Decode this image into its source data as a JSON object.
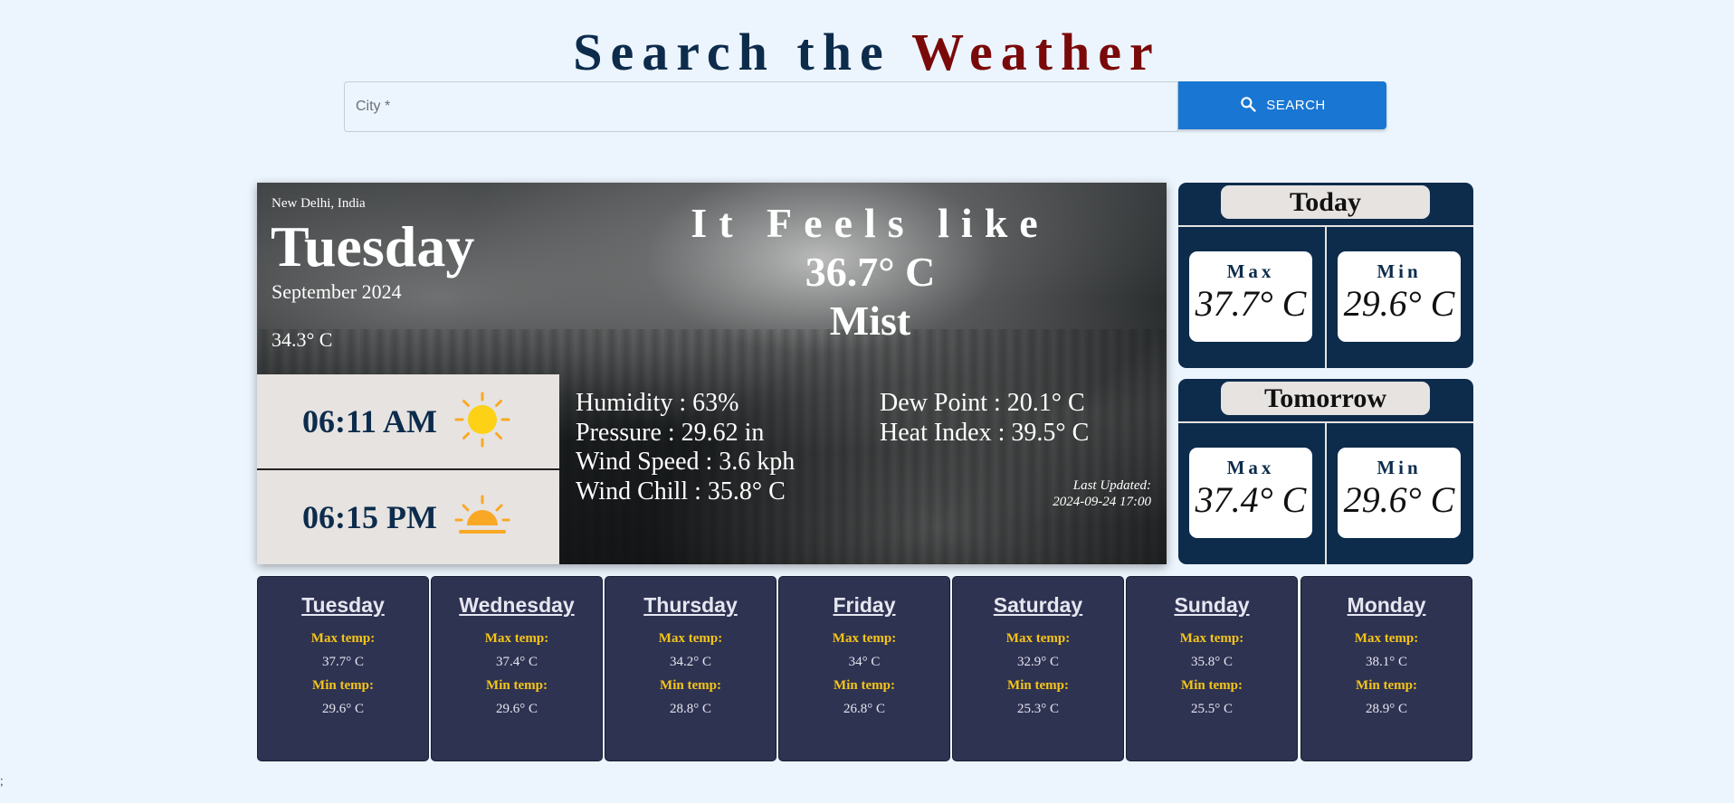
{
  "header": {
    "title_part1": "Search the",
    "title_part2": "Weather"
  },
  "search": {
    "placeholder": "City *",
    "value": "",
    "button_label": "SEARCH"
  },
  "current": {
    "location": "New Delhi, India",
    "day": "Tuesday",
    "month_year": "September 2024",
    "temperature": "34.3° C",
    "feels_like_label": "It Feels like",
    "feels_like_value": "36.7° C",
    "condition": "Mist",
    "sunrise": "06:11 AM",
    "sunset": "06:15 PM",
    "sunrise_icon": "sun-icon",
    "sunset_icon": "sunset-icon",
    "humidity": "Humidity : 63%",
    "pressure": "Pressure : 29.62 in",
    "wind_speed": "Wind Speed : 3.6 kph",
    "wind_chill": "Wind Chill : 35.8° C",
    "dew_point": "Dew Point : 20.1° C",
    "heat_index": "Heat Index : 39.5° C",
    "last_updated_label": "Last Updated:",
    "last_updated_value": "2024-09-24 17:00"
  },
  "today": {
    "title": "Today",
    "max_label": "Max",
    "max": "37.7° C",
    "min_label": "Min",
    "min": "29.6° C"
  },
  "tomorrow": {
    "title": "Tomorrow",
    "max_label": "Max",
    "max": "37.4° C",
    "min_label": "Min",
    "min": "29.6° C"
  },
  "forecast_labels": {
    "max": "Max temp:",
    "min": "Min temp:"
  },
  "forecast": [
    {
      "day": "Tuesday",
      "max": "37.7° C",
      "min": "29.6° C"
    },
    {
      "day": "Wednesday",
      "max": "37.4° C",
      "min": "29.6° C"
    },
    {
      "day": "Thursday",
      "max": "34.2° C",
      "min": "28.8° C"
    },
    {
      "day": "Friday",
      "max": "34° C",
      "min": "26.8° C"
    },
    {
      "day": "Saturday",
      "max": "32.9° C",
      "min": "25.3° C"
    },
    {
      "day": "Sunday",
      "max": "35.8° C",
      "min": "25.5° C"
    },
    {
      "day": "Monday",
      "max": "38.1° C",
      "min": "28.9° C"
    }
  ],
  "colors": {
    "background": "#ecf5fd",
    "navy": "#0d2c4c",
    "accent_red": "#7a0a0a",
    "button_blue": "#1976d2",
    "forecast_card": "#2f3352",
    "forecast_label": "#f5c518"
  },
  "footer": {
    "corner_text": ";"
  }
}
